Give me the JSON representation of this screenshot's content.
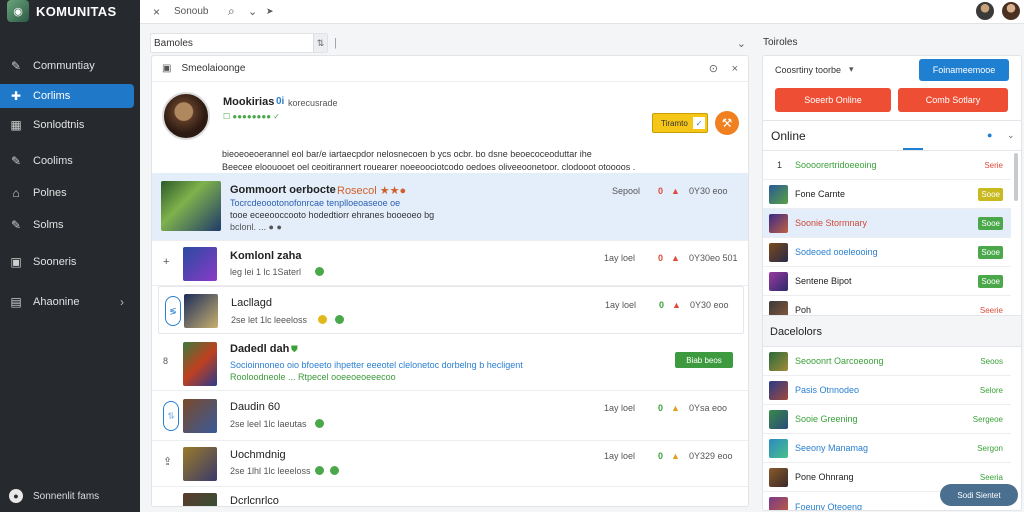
{
  "app": {
    "title": "KOMUNITAS"
  },
  "sidebar": {
    "items": [
      {
        "label": "Communtiay",
        "icon": "pin-icon"
      },
      {
        "label": "Corlims",
        "icon": "puzzle-icon"
      },
      {
        "label": "Sonlodtnis",
        "icon": "grid-icon"
      },
      {
        "label": "Coolims",
        "icon": "pin-icon"
      },
      {
        "label": "Polnes",
        "icon": "home-icon"
      },
      {
        "label": "Solms",
        "icon": "pin-icon"
      },
      {
        "label": "Sooneris",
        "icon": "square-icon"
      },
      {
        "label": "Ahaonine",
        "icon": "layers-icon"
      }
    ],
    "footer": "Sonnenlit fams"
  },
  "topbar": {
    "close": "×",
    "title": "Sonoub",
    "search": "⌕",
    "chevron": "⌄",
    "send": "➤"
  },
  "left": {
    "search_label": "Bamoles",
    "search_right": "⇅",
    "featured": {
      "head": "Smeolaioonge",
      "title": "Mookirias",
      "title_badge": "0i",
      "sub": "korecusrade",
      "tags": "☐ ●●●●●●●● ✓",
      "desc1": "bieoeoeoerannel eol bar/e iartaecpdor nelosnecoen b ycs ocbr. bo dsne beoecoceoduttar ihe",
      "desc2": "Beecee eloouooet oel ceoitirannert rouearer noeeoociotcodo oedoes oliveeoonetoor. clodooot otoooos .",
      "btn_label": "Tiramto",
      "btn_check": "✓"
    },
    "rows": [
      {
        "title": "Gommoort oerbocte",
        "tail": "Rosecol ★★●",
        "meta1": "Tocrcdeoootonofonrcae tenplloeoaseoe oe",
        "meta2": "tooe eceeooccooto hodedtiorr ehranes booeoeo bg",
        "meta3": "bclonl. ... ● ●",
        "time": "Sepool",
        "num": "0",
        "count": "0Y30 eoo"
      },
      {
        "title": "Komlonl zaha",
        "meta1": "leg lei 1 lc 1Saterl",
        "time": "1ay loel",
        "num": "0",
        "count": "0Y30eo 501"
      },
      {
        "title": "Lacllagd",
        "meta1": "2se let 1lc leeeloss",
        "time": "1ay loel",
        "num": "0",
        "count": "0Y30 eoo"
      },
      {
        "title": "Dadedl dah",
        "meta1": "Socioinnoneo oio bfoeeto ihpetter eeeotel clelonetoc dorbelng b hecligent",
        "meta2": "Rooloodneole ... Rtpecel ooeeoeoeeecoo",
        "time": "",
        "num": "",
        "count": "",
        "btn": "Biab beos"
      },
      {
        "title": "Daudin 60",
        "meta1": "2se leel 1lc laeutas",
        "time": "1ay loel",
        "num": "0",
        "count": "0Ysa eoo"
      },
      {
        "title": "Uochmdnig",
        "meta1": "2se 1lhl 1lc leeeloss",
        "time": "1ay loel",
        "num": "0",
        "count": "0Y329 eoo"
      },
      {
        "title": "Dcrlcnrlco",
        "meta1": "",
        "time": "",
        "num": "",
        "count": ""
      }
    ]
  },
  "right": {
    "header": "Toiroles",
    "select_label": "Coosrtiny toorbe",
    "btn_blue": "Foinameemooe",
    "btn_red1": "Soeerb Online",
    "btn_red2": "Comb Sotlary",
    "online_title": "Online",
    "online": [
      {
        "label": "Soooorertridoeeoing",
        "status": "Serie",
        "color": "#3aa13a"
      },
      {
        "label": "Fone Carnte",
        "status": "Sooe",
        "color": "#c8b91f"
      },
      {
        "label": "Soonie Stormnary",
        "status": "Sooe",
        "color": "#4aa84a"
      },
      {
        "label": "Sodeoed ooeleooing",
        "status": "Sooe",
        "color": "#4aa84a"
      },
      {
        "label": "Sentene Bipot",
        "status": "Sooe",
        "color": "#4aa84a"
      },
      {
        "label": "Poh",
        "status": "Seerie",
        "color": "#e04a3a"
      }
    ],
    "dashboard_title": "Dacelolors",
    "dash": [
      {
        "label": "Seooonrt Oarcoeoong",
        "status": "Seoos"
      },
      {
        "label": "Pasis Otnnodeo",
        "status": "Selore"
      },
      {
        "label": "Sooie Greening",
        "status": "Sergeoe"
      },
      {
        "label": "Seeony Manamag",
        "status": "Sergon"
      },
      {
        "label": "Pone Ohnrang",
        "status": "Seeria"
      },
      {
        "label": "Foeuny Oteoeng",
        "status": ""
      }
    ],
    "chat_btn": "Sodi Sientet"
  }
}
